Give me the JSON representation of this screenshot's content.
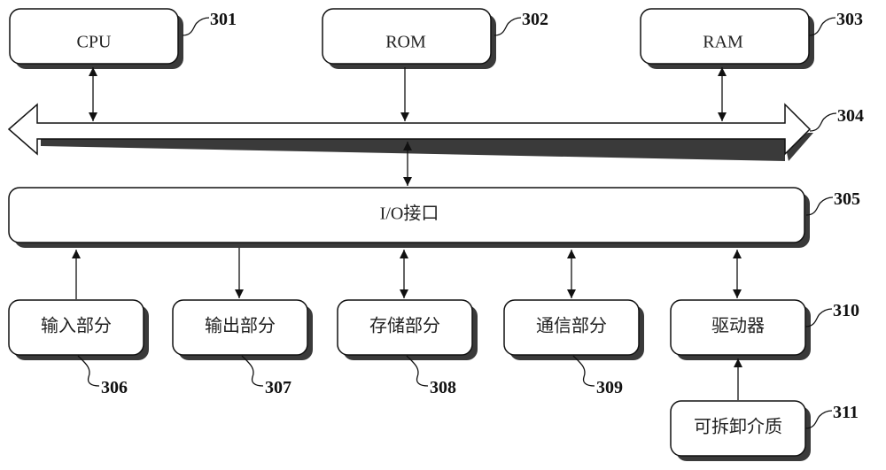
{
  "diagram": {
    "title": "",
    "colors": {
      "stroke": "#111111",
      "shadow": "#3a3a3a",
      "fill": "#ffffff"
    },
    "boxes": {
      "cpu": {
        "label": "CPU",
        "ref": "301"
      },
      "rom": {
        "label": "ROM",
        "ref": "302"
      },
      "ram": {
        "label": "RAM",
        "ref": "303"
      },
      "bus": {
        "label": "",
        "ref": "304"
      },
      "io": {
        "label": "I/O接口",
        "ref": "305"
      },
      "input": {
        "label": "输入部分",
        "ref": "306"
      },
      "output": {
        "label": "输出部分",
        "ref": "307"
      },
      "storage": {
        "label": "存储部分",
        "ref": "308"
      },
      "comm": {
        "label": "通信部分",
        "ref": "309"
      },
      "drive": {
        "label": "驱动器",
        "ref": "310"
      },
      "media": {
        "label": "可拆卸介质",
        "ref": "311"
      }
    },
    "connections": [
      {
        "from": "cpu",
        "to": "bus",
        "direction": "bidirectional"
      },
      {
        "from": "rom",
        "to": "bus",
        "direction": "to"
      },
      {
        "from": "ram",
        "to": "bus",
        "direction": "bidirectional"
      },
      {
        "from": "bus",
        "to": "io",
        "direction": "bidirectional"
      },
      {
        "from": "input",
        "to": "io",
        "direction": "to"
      },
      {
        "from": "io",
        "to": "output",
        "direction": "to"
      },
      {
        "from": "io",
        "to": "storage",
        "direction": "bidirectional"
      },
      {
        "from": "io",
        "to": "comm",
        "direction": "bidirectional"
      },
      {
        "from": "io",
        "to": "drive",
        "direction": "bidirectional"
      },
      {
        "from": "media",
        "to": "drive",
        "direction": "to"
      }
    ]
  }
}
